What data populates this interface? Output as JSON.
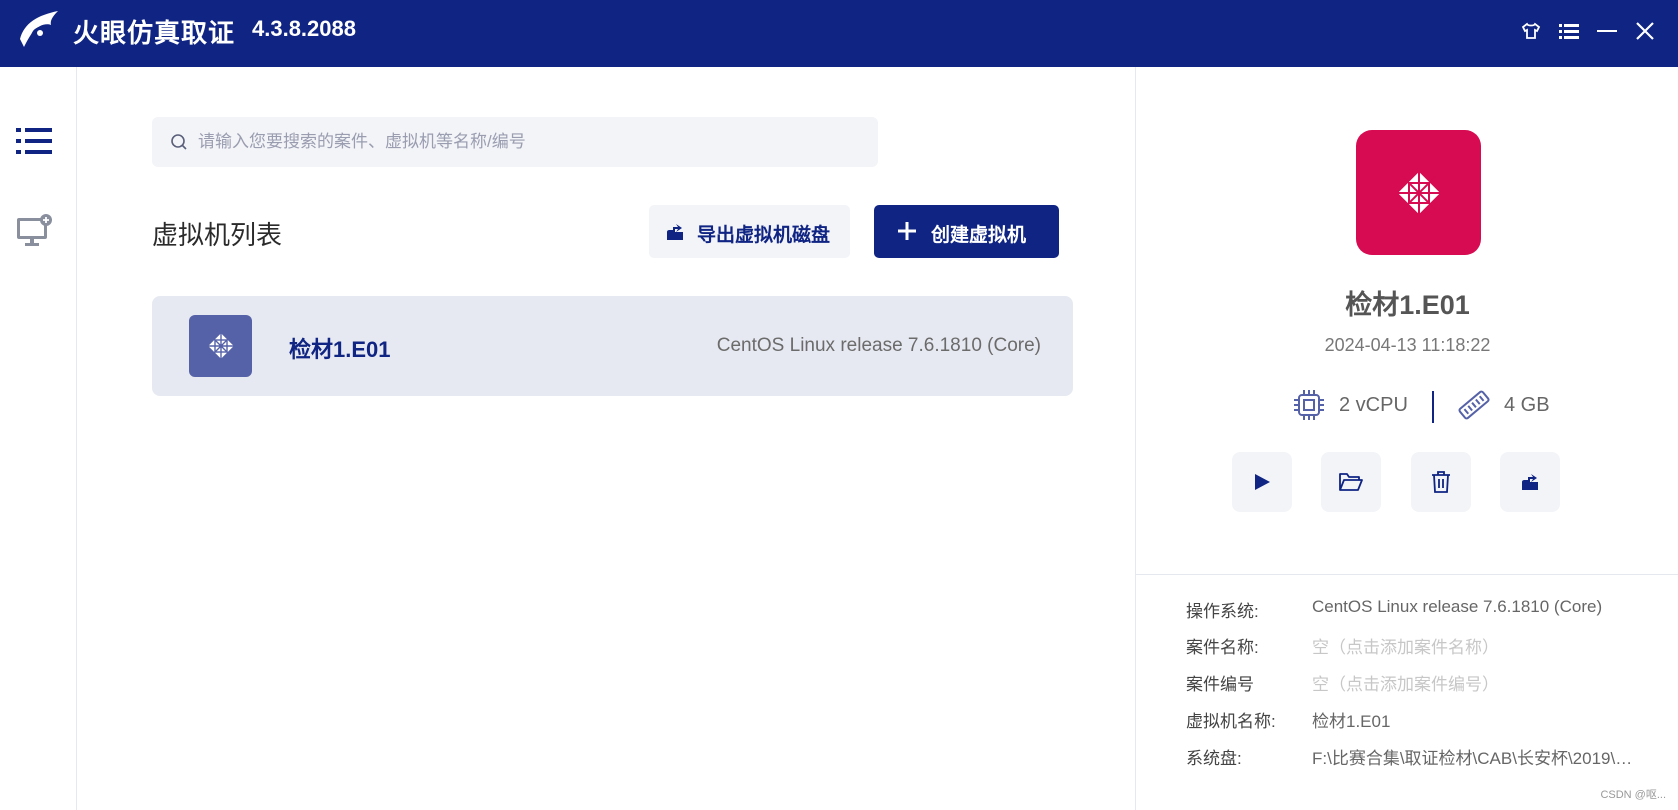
{
  "app": {
    "title": "火眼仿真取证",
    "version": "4.3.8.2088"
  },
  "colors": {
    "brand": "#0f2483",
    "vm_accent": "#d60b51",
    "vm_thumb": "#5562a8"
  },
  "window_controls": [
    {
      "name": "skin-icon"
    },
    {
      "name": "menu-icon"
    },
    {
      "name": "minimize-icon"
    },
    {
      "name": "close-icon"
    }
  ],
  "sidebar": {
    "items": [
      {
        "name": "list-icon"
      },
      {
        "name": "add-vm-icon"
      }
    ]
  },
  "search": {
    "placeholder": "请输入您要搜索的案件、虚拟机等名称/编号",
    "value": ""
  },
  "main": {
    "section_title": "虚拟机列表",
    "export_label": "导出虚拟机磁盘",
    "create_label": "创建虚拟机",
    "vm_list": [
      {
        "name": "检材1.E01",
        "os": "CentOS Linux release 7.6.1810 (Core)"
      }
    ]
  },
  "detail": {
    "name": "检材1.E01",
    "created": "2024-04-13 11:18:22",
    "cpu": "2 vCPU",
    "memory": "4 GB",
    "actions": [
      "play-icon",
      "folder-open-icon",
      "trash-icon",
      "export-disk-icon"
    ],
    "info": [
      {
        "key": "操作系统:",
        "value": "CentOS Linux release 7.6.1810 (Core)",
        "placeholder": false
      },
      {
        "key": "案件名称:",
        "value": "空（点击添加案件名称）",
        "placeholder": true
      },
      {
        "key": "案件编号",
        "value": "空（点击添加案件编号）",
        "placeholder": true
      },
      {
        "key": "虚拟机名称:",
        "value": "检材1.E01",
        "placeholder": false
      },
      {
        "key": "系统盘:",
        "value": "F:\\比赛合集\\取证检材\\CAB\\长安杯\\2019\\…",
        "placeholder": false
      }
    ]
  },
  "watermark": "CSDN @呕..."
}
